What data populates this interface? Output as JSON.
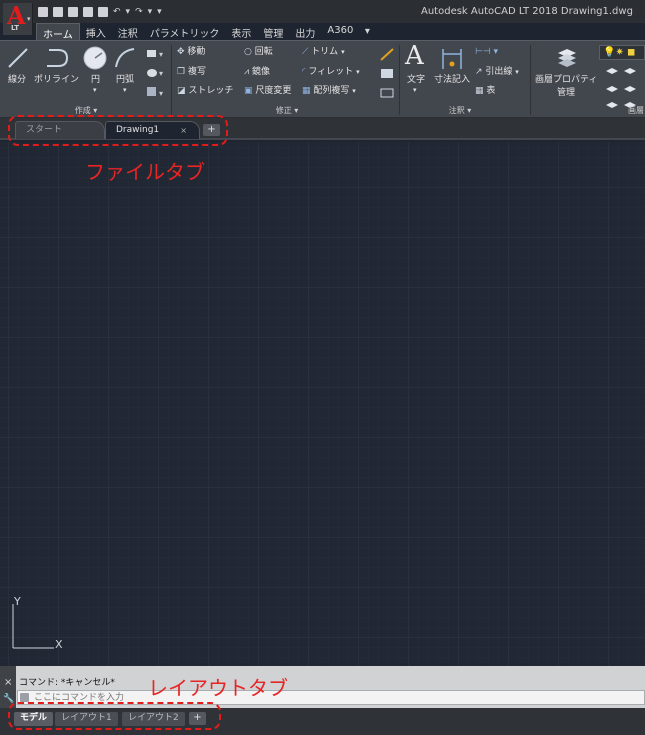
{
  "window": {
    "title": "Autodesk AutoCAD LT 2018    Drawing1.dwg",
    "app_logo_letter": "A",
    "app_logo_badge": "LT"
  },
  "ribbon_tabs": [
    "ホーム",
    "挿入",
    "注釈",
    "パラメトリック",
    "表示",
    "管理",
    "出力",
    "A360"
  ],
  "ribbon": {
    "draw": {
      "title": "作成",
      "line": "線分",
      "polyline": "ポリライン",
      "circle": "円",
      "arc": "円弧"
    },
    "modify": {
      "title": "修正",
      "move": "移動",
      "copy": "複写",
      "stretch": "ストレッチ",
      "rotate": "回転",
      "mirror": "鏡像",
      "scale": "尺度変更",
      "trim": "トリム",
      "fillet": "フィレット",
      "array": "配列複写"
    },
    "annotation": {
      "title": "注釈",
      "text": "文字",
      "dimension": "寸法記入",
      "leader": "引出線",
      "table": "表"
    },
    "layers": {
      "layer_properties_line1": "画層プロパティ",
      "layer_properties_line2": "管理",
      "title": "画層"
    }
  },
  "file_tabs": {
    "start": "スタート",
    "drawing": "Drawing1",
    "close_glyph": "×",
    "add_glyph": "+"
  },
  "ucs": {
    "x_label": "X",
    "y_label": "Y"
  },
  "command_line": {
    "history": "コマンド:  *キャンセル*",
    "placeholder": "ここにコマンドを入力",
    "close_glyph": "×"
  },
  "layout_tabs": {
    "model": "モデル",
    "layout1": "レイアウト1",
    "layout2": "レイアウト2",
    "add_glyph": "+"
  },
  "annotations": {
    "file_tab_label": "ファイルタブ",
    "layout_tab_label": "レイアウトタブ",
    "color": "#e21b1b"
  },
  "colors": {
    "canvas_bg": "#212834",
    "ribbon_bg": "#42464d",
    "accent_red": "#e21b1b"
  }
}
